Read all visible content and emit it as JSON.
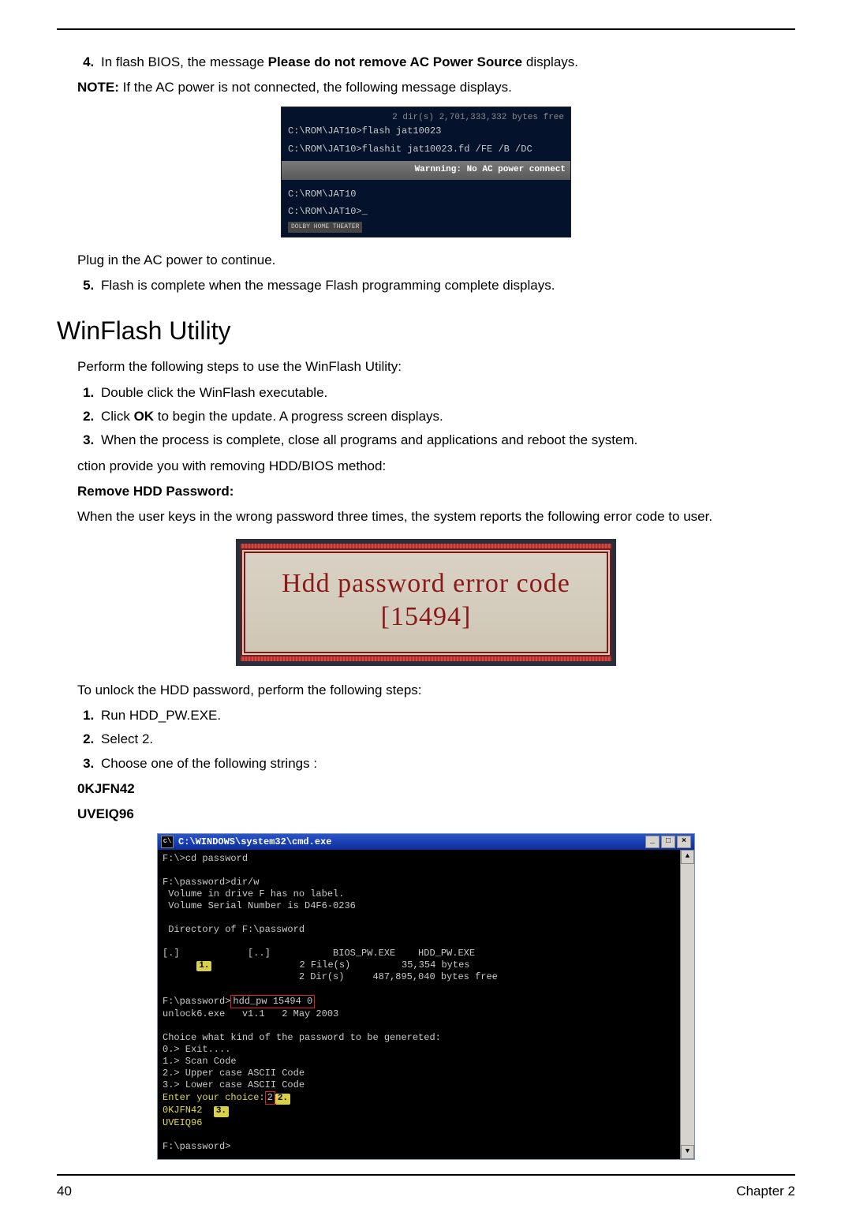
{
  "step4": {
    "prefix": "In flash BIOS, the message ",
    "bold": "Please do not remove AC Power Source",
    "suffix": " displays."
  },
  "note": {
    "label": "NOTE:",
    "text": " If the AC power is not connected, the following message displays."
  },
  "shot1": {
    "topline": "2 dir(s)   2,701,333,332 bytes free",
    "line1": "C:\\ROM\\JAT10>flash jat10023",
    "line2": "C:\\ROM\\JAT10>flashit jat10023.fd /FE /B /DC",
    "warn": "Warnning: No AC power connect",
    "line3": "C:\\ROM\\JAT10",
    "line4": "C:\\ROM\\JAT10>_",
    "dolby": "DOLBY HOME THEATER"
  },
  "plug_note": "Plug in the AC power to continue.",
  "step5": "Flash is complete when the message Flash programming complete displays.",
  "heading": "WinFlash Utility",
  "intro": "Perform the following steps to use the WinFlash Utility:",
  "wf_step1": "Double click the WinFlash executable.",
  "wf_step2_pre": "Click ",
  "wf_step2_bold": "OK",
  "wf_step2_post": " to begin the update. A progress screen displays.",
  "wf_step3": "When the process is complete, close all programs and applications and reboot the system.",
  "ction": "ction provide you with removing HDD/BIOS method:",
  "remove_head": "Remove HDD Password:",
  "remove_intro": "When the user keys in the wrong password three times, the system reports the following error code to user.",
  "errcode": {
    "line1": "Hdd password error code",
    "line2": "[15494]"
  },
  "unlock_intro": "To unlock the HDD password, perform the following steps:",
  "u_step1": "Run HDD_PW.EXE.",
  "u_step2": "Select 2.",
  "u_step3": "Choose one of the following strings :",
  "string1": "0KJFN42",
  "string2": "UVEIQ96",
  "cmd": {
    "title": "C:\\WINDOWS\\system32\\cmd.exe",
    "l1": "F:\\>cd password",
    "l2": "F:\\password>dir/w",
    "l3": " Volume in drive F has no label.",
    "l4": " Volume Serial Number is D4F6-0236",
    "l5": " Directory of F:\\password",
    "l6a": "[.]            [..]           BIOS_PW.EXE    HDD_PW.EXE",
    "l6b": "               2 File(s)         35,354 bytes",
    "l6c": "               2 Dir(s)     487,895,040 bytes free",
    "l7a": "F:\\password>",
    "l7b": "hdd_pw 15494 0",
    "l8": "unlock6.exe   v1.1   2 May 2003",
    "l9": "Choice what kind of the password to be genereted:",
    "l10": "0.> Exit....",
    "l11": "1.> Scan Code",
    "l12": "2.> Upper case ASCII Code",
    "l13": "3.> Lower case ASCII Code",
    "l14a": "Enter your choice:",
    "l14b": "2",
    "l15": "0KJFN42",
    "l16": "UVEIQ96",
    "l17": "F:\\password>",
    "m1": "1.",
    "m2": "2.",
    "m3": "3."
  },
  "footer": {
    "page": "40",
    "chapter": "Chapter 2"
  }
}
